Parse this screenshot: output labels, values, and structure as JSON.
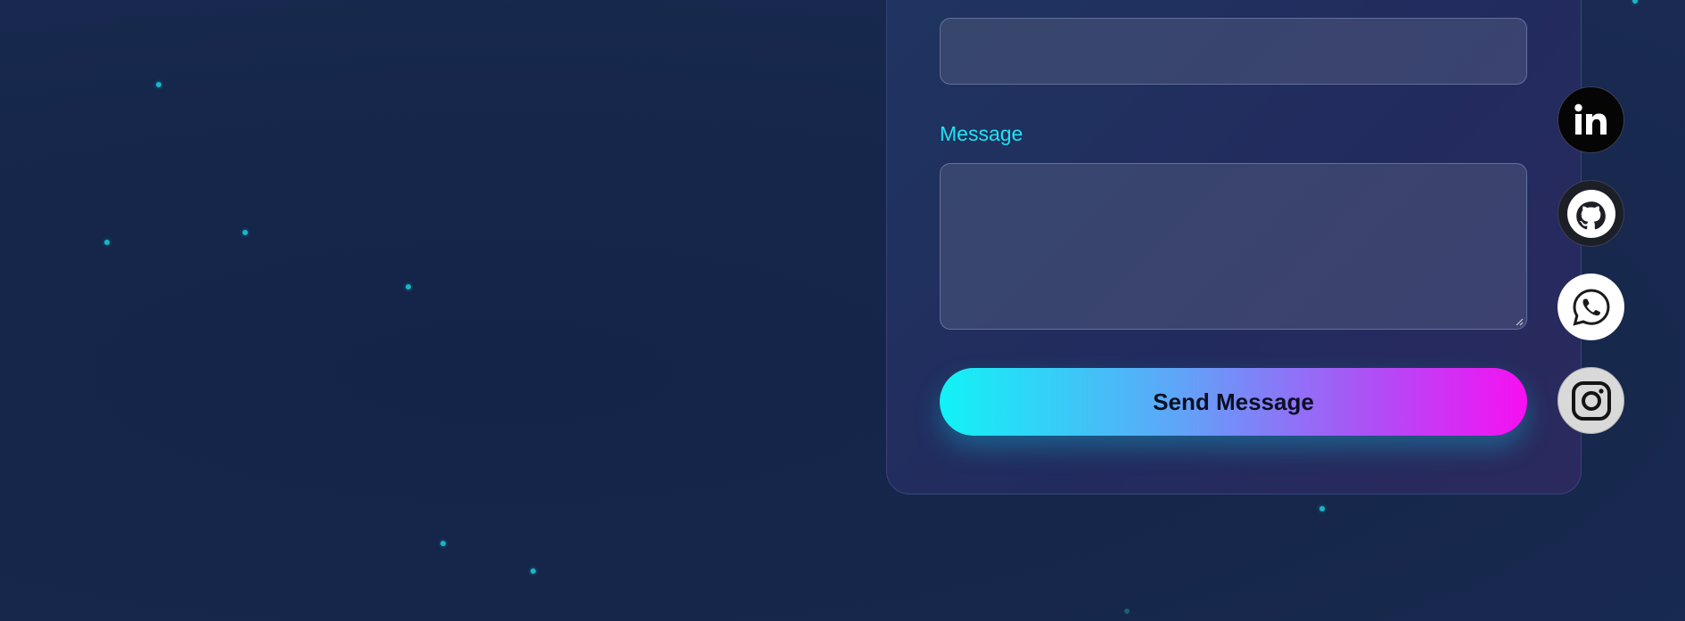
{
  "form": {
    "message_label": "Message",
    "send_label": "Send Message"
  },
  "social": {
    "linkedin_text": "in"
  },
  "colors": {
    "background": "#16254a",
    "accent_cyan": "#1fe3f2",
    "button_gradient_start": "#11f3f6",
    "button_gradient_end": "#f70ff2",
    "particle": "#17b6c9"
  },
  "icons": [
    "linkedin-icon",
    "github-icon",
    "whatsapp-icon",
    "instagram-icon",
    "resize-handle-icon"
  ]
}
